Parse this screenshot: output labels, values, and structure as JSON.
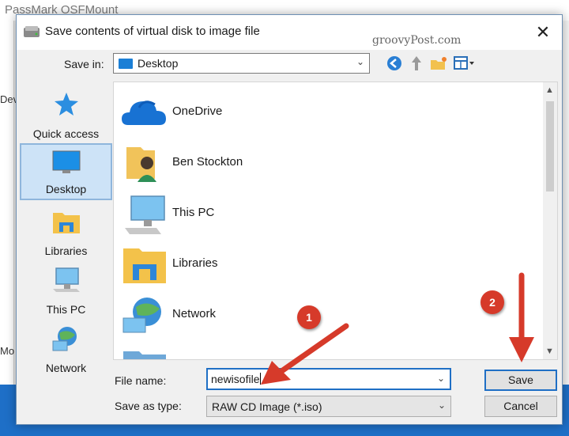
{
  "background_app": {
    "title": "PassMark OSFMount",
    "left_fragment_top": "Dev",
    "left_fragment_bottom": "Mo"
  },
  "dialog": {
    "title": "Save contents of virtual disk to image file",
    "close_glyph": "✕",
    "watermark": "groovyPost.com",
    "save_in_label": "Save in:",
    "save_in_value": "Desktop",
    "toolbar_icons": [
      "back-icon",
      "up-folder-icon",
      "new-folder-icon",
      "view-menu-icon"
    ]
  },
  "places": [
    {
      "label": "Quick access",
      "icon": "star-icon"
    },
    {
      "label": "Desktop",
      "icon": "desktop-icon",
      "selected": true
    },
    {
      "label": "Libraries",
      "icon": "libraries-icon"
    },
    {
      "label": "This PC",
      "icon": "computer-icon"
    },
    {
      "label": "Network",
      "icon": "network-icon"
    }
  ],
  "items": [
    {
      "name": "OneDrive",
      "icon": "cloud-icon"
    },
    {
      "name": "Ben Stockton",
      "icon": "user-folder-icon"
    },
    {
      "name": "This PC",
      "icon": "computer-icon"
    },
    {
      "name": "Libraries",
      "icon": "libraries-icon"
    },
    {
      "name": "Network",
      "icon": "network-icon"
    }
  ],
  "file_name": {
    "label": "File name:",
    "value": "newisofile"
  },
  "save_as_type": {
    "label": "Save as type:",
    "value": "RAW CD Image (*.iso)"
  },
  "buttons": {
    "save": "Save",
    "cancel": "Cancel"
  },
  "annotations": {
    "step1": "1",
    "step2": "2",
    "color": "#d63a2a"
  }
}
